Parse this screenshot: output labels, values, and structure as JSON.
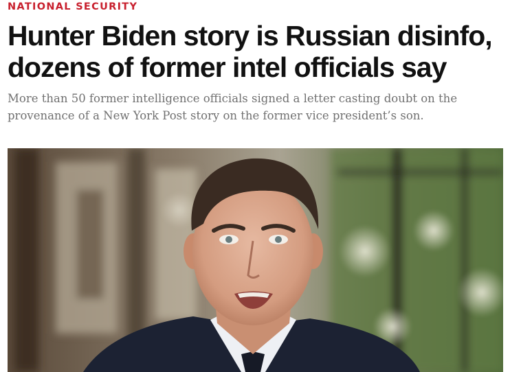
{
  "article": {
    "kicker": "NATIONAL SECURITY",
    "headline_line1": "Hunter Biden story is Russian disinfo,",
    "headline_line2": "dozens of former intel officials say",
    "dek_line1": "More than 50 former intelligence officials signed a letter casting doubt on the",
    "dek_line2": "provenance of a New York Post story on the former vice president’s son."
  },
  "colors": {
    "kicker": "#c8202e",
    "headline": "#111111",
    "dek": "#707070"
  },
  "image": {
    "subject": "man in suit speaking, blurred window background with greenery"
  }
}
